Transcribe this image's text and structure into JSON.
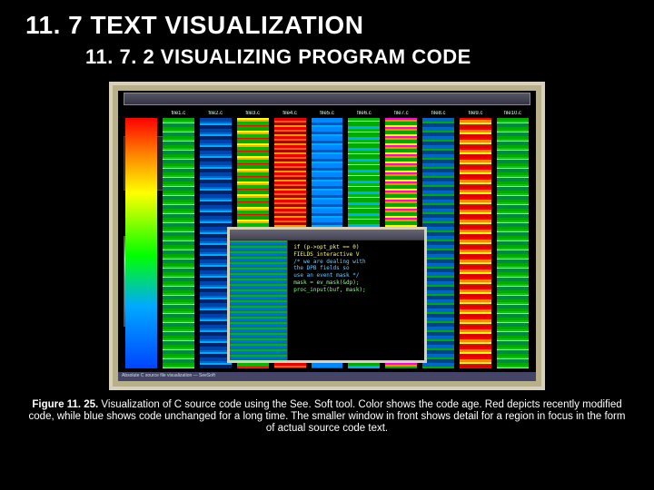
{
  "heading": "11. 7 TEXT VISUALIZATION",
  "subheading": "11. 7. 2 VISUALIZING PROGRAM CODE",
  "figure": {
    "files": [
      "",
      "file1.c",
      "file2.c",
      "file3.c",
      "file4.c",
      "file5.c",
      "file6.c",
      "file7.c",
      "file8.c",
      "file9.c",
      "file10.c"
    ],
    "detail_lines": [
      "if (p->opt_pkt == 0)",
      "    FIELDS_interactive V",
      "/* we are dealing with",
      "   the DPB fields so ",
      "   use an event mask  */",
      "mask = ev_mask(&dp);",
      "proc_input(buf, mask);"
    ],
    "status": "Absolute C source file visualization — SeeSoft"
  },
  "caption_label": "Figure 11. 25.",
  "caption_text": " Visualization of C source code using the See. Soft tool. Color shows the code age. Red depicts recently modified code, while blue shows code unchanged for a long time. The smaller window in front shows detail for a region in focus in the form of actual source code text."
}
